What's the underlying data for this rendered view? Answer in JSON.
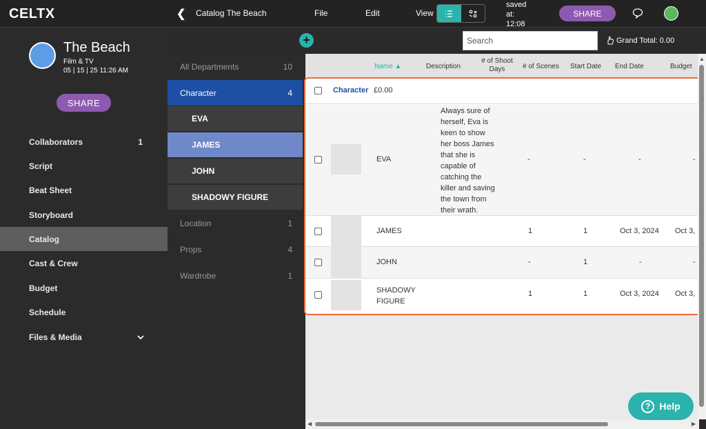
{
  "app": {
    "logo": "CELTX"
  },
  "topbar": {
    "breadcrumb": "Catalog The Beach",
    "menu_file": "File",
    "menu_edit": "Edit",
    "menu_view": "View",
    "saved_line1": "saved",
    "saved_line2": "at:",
    "saved_line3": "12:08",
    "share_label": "SHARE"
  },
  "project": {
    "title": "The Beach",
    "type": "Film & TV",
    "date": "05 | 15 | 25 11:26 AM",
    "share_label": "SHARE"
  },
  "sidebar": {
    "items": [
      {
        "label": "Collaborators",
        "count": "1"
      },
      {
        "label": "Script"
      },
      {
        "label": "Beat Sheet"
      },
      {
        "label": "Storyboard"
      },
      {
        "label": "Catalog"
      },
      {
        "label": "Cast & Crew"
      },
      {
        "label": "Budget"
      },
      {
        "label": "Schedule"
      },
      {
        "label": "Files & Media"
      }
    ]
  },
  "departments": {
    "all": {
      "label": "All Departments",
      "count": "10"
    },
    "character": {
      "label": "Character",
      "count": "4"
    },
    "subitems": [
      "EVA",
      "JAMES",
      "JOHN",
      "SHADOWY FIGURE"
    ],
    "location": {
      "label": "Location",
      "count": "1"
    },
    "props": {
      "label": "Props",
      "count": "4"
    },
    "wardrobe": {
      "label": "Wardrobe",
      "count": "1"
    }
  },
  "search": {
    "placeholder": "Search"
  },
  "grand_total": "Grand Total: 0.00",
  "table": {
    "headers": {
      "name": "Name",
      "description": "Description",
      "shoot_days_1": "# of Shoot",
      "shoot_days_2": "Days",
      "scenes": "# of Scenes",
      "start_date": "Start Date",
      "end_date": "End Date",
      "budget": "Budget"
    },
    "group": {
      "label": "Character",
      "total": "£0.00"
    },
    "rows": [
      {
        "name": "EVA",
        "description": [
          "Always sure of",
          "herself, Eva is",
          "keen to show",
          "her boss James",
          "that she is",
          "capable of",
          "catching the",
          "killer and saving",
          "the town from",
          "their wrath."
        ],
        "shoot_days": "-",
        "scenes": "-",
        "end_date": "-",
        "budget": "-"
      },
      {
        "name": "JAMES",
        "shoot_days": "1",
        "scenes": "1",
        "end_date": "Oct 3, 2024",
        "budget": "Oct 3,"
      },
      {
        "name": "JOHN",
        "shoot_days": "-",
        "scenes": "1",
        "end_date": "-",
        "budget": "-"
      },
      {
        "name_1": "SHADOWY",
        "name_2": "FIGURE",
        "shoot_days": "1",
        "scenes": "1",
        "end_date": "Oct 3, 2024",
        "budget": "Oct 3,"
      }
    ]
  },
  "help": {
    "label": "Help"
  },
  "colors": {
    "accent": "#2bb3ad",
    "share": "#8e5ab0",
    "selected_dept": "#1d4fa5",
    "highlight": "#f06c37"
  }
}
